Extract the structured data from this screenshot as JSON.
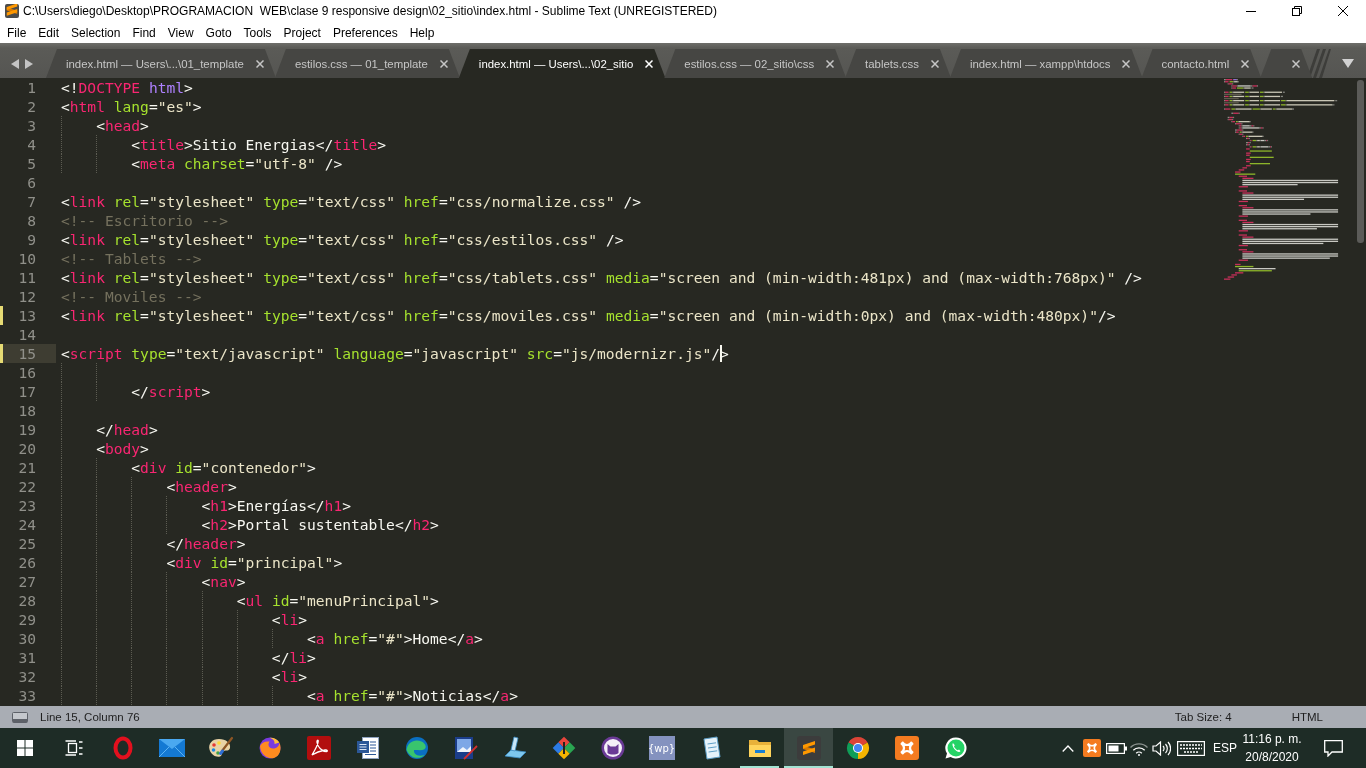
{
  "window": {
    "title": "C:\\Users\\diego\\Desktop\\PROGRAMACION  WEB\\clase 9 responsive design\\02_sitio\\index.html - Sublime Text (UNREGISTERED)"
  },
  "menu": [
    {
      "label": "File"
    },
    {
      "label": "Edit"
    },
    {
      "label": "Selection"
    },
    {
      "label": "Find"
    },
    {
      "label": "View"
    },
    {
      "label": "Goto"
    },
    {
      "label": "Tools"
    },
    {
      "label": "Project"
    },
    {
      "label": "Preferences"
    },
    {
      "label": "Help"
    }
  ],
  "tabs": [
    {
      "label": "index.html — Users\\...\\01_template",
      "selected": false
    },
    {
      "label": "estilos.css — 01_template",
      "selected": false
    },
    {
      "label": "index.html — Users\\...\\02_sitio",
      "selected": true
    },
    {
      "label": "estilos.css — 02_sitio\\css",
      "selected": false
    },
    {
      "label": "tablets.css",
      "selected": false
    },
    {
      "label": "index.html — xampp\\htdocs",
      "selected": false
    },
    {
      "label": "contacto.html",
      "selected": false
    },
    {
      "selected": false
    }
  ],
  "editor": {
    "lines": [
      {
        "number": "1",
        "text": "<!DOCTYPE html>",
        "current": false,
        "modified": false
      },
      {
        "number": "2",
        "text": "<html lang=\"es\">",
        "current": false,
        "modified": false
      },
      {
        "number": "3",
        "text": "    <head>",
        "current": false,
        "modified": false
      },
      {
        "number": "4",
        "text": "        <title>Sitio Energias</title>",
        "current": false,
        "modified": false
      },
      {
        "number": "5",
        "text": "        <meta charset=\"utf-8\" />",
        "current": false,
        "modified": false
      },
      {
        "number": "6",
        "current": false,
        "modified": false
      },
      {
        "number": "7",
        "text": "<link rel=\"stylesheet\" type=\"text/css\" href=\"css/normalize.css\" />",
        "current": false,
        "modified": false
      },
      {
        "number": "8",
        "text": "<!-- Escritorio -->",
        "current": false,
        "modified": false
      },
      {
        "number": "9",
        "text": "<link rel=\"stylesheet\" type=\"text/css\" href=\"css/estilos.css\" />",
        "current": false,
        "modified": false
      },
      {
        "number": "10",
        "text": "<!-- Tablets -->",
        "current": false,
        "modified": false
      },
      {
        "number": "11",
        "text": "<link rel=\"stylesheet\" type=\"text/css\" href=\"css/tablets.css\" media=\"screen and (min-width:481px) and (max-width:768px)\" />",
        "current": false,
        "modified": false
      },
      {
        "number": "12",
        "text": "<!-- Moviles -->",
        "current": false,
        "modified": false
      },
      {
        "number": "13",
        "text": "<link rel=\"stylesheet\" type=\"text/css\" href=\"css/moviles.css\" media=\"screen and (min-width:0px) and (max-width:480px)\"/>",
        "current": false,
        "modified": true
      },
      {
        "number": "14",
        "current": false,
        "modified": false
      },
      {
        "number": "15",
        "text": "<script type=\"text/javascript\" language=\"javascript\" src=\"js/modernizr.js\"/",
        "after_caret": ">",
        "current": true,
        "modified": true
      },
      {
        "number": "16",
        "current": false,
        "modified": false
      },
      {
        "number": "17",
        "text": "        </script>",
        "current": false,
        "modified": false
      },
      {
        "number": "18",
        "current": false,
        "modified": false
      },
      {
        "number": "19",
        "text": "    </head>",
        "current": false,
        "modified": false
      },
      {
        "number": "20",
        "text": "    <body>",
        "current": false,
        "modified": false
      },
      {
        "number": "21",
        "text": "        <div id=\"contenedor\">",
        "current": false,
        "modified": false
      },
      {
        "number": "22",
        "text": "            <header>",
        "current": false,
        "modified": false
      },
      {
        "number": "23",
        "text": "                <h1>Energías</h1>",
        "current": false,
        "modified": false
      },
      {
        "number": "24",
        "text": "                <h2>Portal sustentable</h2>",
        "current": false,
        "modified": false
      },
      {
        "number": "25",
        "text": "            </header>",
        "current": false,
        "modified": false
      },
      {
        "number": "26",
        "text": "            <div id=\"principal\">",
        "current": false,
        "modified": false
      },
      {
        "number": "27",
        "text": "                <nav>",
        "current": false,
        "modified": false
      },
      {
        "number": "28",
        "text": "                    <ul id=\"menuPrincipal\">",
        "current": false,
        "modified": false
      },
      {
        "number": "29",
        "text": "                        <li>",
        "current": false,
        "modified": false
      },
      {
        "number": "30",
        "text": "                            <a href=\"#\">Home</a>",
        "current": false,
        "modified": false
      },
      {
        "number": "31",
        "text": "                        </li>",
        "current": false,
        "modified": false
      },
      {
        "number": "32",
        "text": "                        <li>",
        "current": false,
        "modified": false
      },
      {
        "number": "33",
        "text": "                            <a href=\"#\">Noticias</a>",
        "current": false,
        "modified": false
      }
    ]
  },
  "status_bar": {
    "position": "Line 15, Column 76",
    "tab_size": "Tab Size: 4",
    "syntax": "HTML"
  },
  "taskbar": {
    "items": [
      {
        "kind": "start",
        "running": false,
        "selected": false
      },
      {
        "kind": "taskview",
        "running": false,
        "selected": false
      },
      {
        "kind": "ring",
        "running": false,
        "selected": false
      },
      {
        "kind": "envelope",
        "running": false,
        "selected": false
      },
      {
        "kind": "palette",
        "running": false,
        "selected": false
      },
      {
        "kind": "flameglobe",
        "running": false,
        "selected": false
      },
      {
        "kind": "pdf",
        "running": false,
        "selected": false
      },
      {
        "kind": "document",
        "running": false,
        "selected": false
      },
      {
        "kind": "wavecircle",
        "running": false,
        "selected": false
      },
      {
        "kind": "screenpen",
        "running": false,
        "selected": false
      },
      {
        "kind": "scanner",
        "running": false,
        "selected": false
      },
      {
        "kind": "diamond",
        "running": false,
        "selected": false
      },
      {
        "kind": "catface",
        "running": false,
        "selected": false
      },
      {
        "kind": "texttile",
        "label": "{wp}",
        "running": false,
        "selected": false
      },
      {
        "kind": "notepad",
        "running": false,
        "selected": false
      },
      {
        "kind": "folder",
        "running": true,
        "selected": false
      },
      {
        "kind": "stripelogo",
        "running": true,
        "selected": true
      },
      {
        "kind": "segmentedcircle",
        "running": false,
        "selected": false
      },
      {
        "kind": "knottile",
        "running": false,
        "selected": false
      },
      {
        "kind": "chatbubble",
        "running": false,
        "selected": false
      }
    ],
    "tray": {
      "language": "ESP",
      "time": "11:16 p. m.",
      "date": "20/8/2020"
    }
  }
}
